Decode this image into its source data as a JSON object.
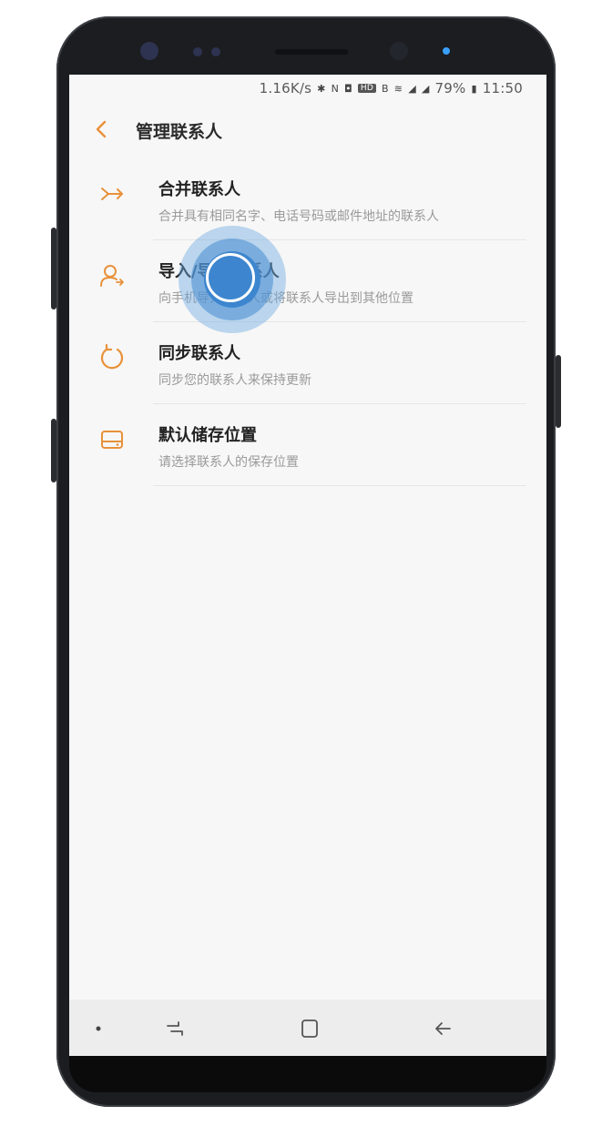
{
  "status_bar": {
    "speed": "1.16K/s",
    "battery": "79%",
    "time": "11:50",
    "icons": [
      "bluetooth-icon",
      "nfc-icon",
      "hd-icon",
      "data-icon",
      "signal-icon",
      "battery-icon"
    ]
  },
  "header": {
    "title": "管理联系人"
  },
  "items": [
    {
      "title": "合并联系人",
      "subtitle": "合并具有相同名字、电话号码或邮件地址的联系人",
      "icon": "merge-icon"
    },
    {
      "title": "导入/导出联系人",
      "subtitle": "向手机导入联系人或将联系人导出到其他位置",
      "icon": "import-export-icon"
    },
    {
      "title": "同步联系人",
      "subtitle": "同步您的联系人来保持更新",
      "icon": "sync-icon"
    },
    {
      "title": "默认储存位置",
      "subtitle": "请选择联系人的保存位置",
      "icon": "storage-icon"
    }
  ],
  "colors": {
    "accent": "#e8913a",
    "touch": "#3d86cf"
  },
  "navbar": {
    "icons": [
      "dot-icon",
      "recents-icon",
      "home-icon",
      "back-icon"
    ]
  }
}
